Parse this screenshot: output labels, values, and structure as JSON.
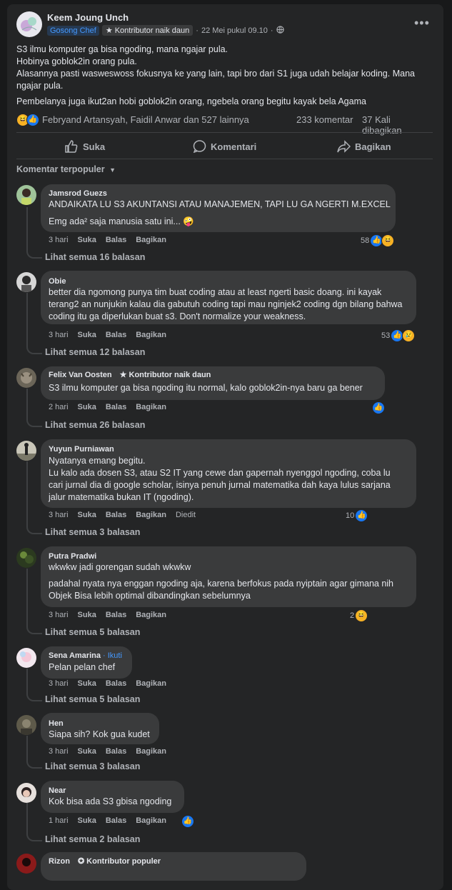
{
  "post": {
    "author": "Keem Joung Unch",
    "badge_group": "Gosong Chef",
    "badge_contrib": "Kontributor naik daun",
    "timestamp": "22 Mei pukul 09.10",
    "privacy_icon": "globe-icon",
    "text": [
      "S3 ilmu komputer ga bisa ngoding, mana ngajar pula.",
      "Hobinya goblok2in orang pula.",
      "Alasannya pasti wasweswoss fokusnya ke yang lain, tapi bro dari S1 juga udah belajar koding. Mana ngajar pula.",
      "Pembelanya juga ikut2an hobi goblok2in orang, ngebela orang begitu kayak bela Agama"
    ],
    "reactors": "Febryand Artansyah, Faidil Anwar dan 527 lainnya",
    "comments_count": "233 komentar",
    "shares_count": "37 Kali dibagikan"
  },
  "actions": {
    "like": "Suka",
    "comment": "Komentari",
    "share": "Bagikan"
  },
  "sort_label": "Komentar terpopuler",
  "labels": {
    "like": "Suka",
    "reply": "Balas",
    "share": "Bagikan",
    "edited": "Diedit"
  },
  "colors": {
    "background": "#18191a",
    "card": "#242526",
    "bubble": "#3a3b3c",
    "accent": "#1877f2",
    "link": "#4599ff"
  },
  "comments": [
    {
      "name": "Jamsrod Guezs",
      "text1": "ANDAIKATA LU S3 AKUNTANSI ATAU MANAJEMEN, TAPI LU GA NGERTI M.EXCEL",
      "text2": "Emg ada² saja manusia satu ini... 🤪",
      "time": "3 hari",
      "react_count": "58",
      "replies": "Lihat semua 16 balasan"
    },
    {
      "name": "Obie",
      "text1": "better dia ngomong punya tim buat coding atau at least ngerti basic doang. ini kayak terang2 an nunjukin kalau dia gabutuh coding tapi mau nginjek2 coding dgn bilang bahwa coding itu ga diperlukan buat s3. Don't normalize your weakness.",
      "time": "3 hari",
      "react_count": "53",
      "replies": "Lihat semua 12 balasan"
    },
    {
      "name": "Felix Van Oosten",
      "badge": "Kontributor naik daun",
      "text1": "S3 ilmu komputer ga bisa ngoding itu normal, kalo goblok2in-nya baru ga bener",
      "time": "2 hari",
      "replies": "Lihat semua 26 balasan"
    },
    {
      "name": "Yuyun Purniawan",
      "text1": "Nyatanya emang begitu.",
      "text2": "Lu kalo ada dosen S3, atau S2 IT yang cewe dan gapernah nyenggol ngoding, coba lu cari jurnal dia di google scholar, isinya penuh jurnal matematika dah kaya lulus sarjana jalur matematika bukan IT (ngoding).",
      "time": "3 hari",
      "react_count": "10",
      "replies": "Lihat semua 3 balasan"
    },
    {
      "name": "Putra Pradwi",
      "text1": "wkwkw jadi gorengan sudah wkwkw",
      "text2": "padahal nyata nya enggan ngoding aja, karena berfokus pada nyiptain agar gimana nih Objek Bisa lebih optimal dibandingkan sebelumnya",
      "time": "3 hari",
      "react_count": "2",
      "replies": "Lihat semua 5 balasan"
    },
    {
      "name": "Sena Amarina",
      "follow": "· Ikuti",
      "text1": "Pelan pelan chef",
      "time": "3 hari",
      "replies": "Lihat semua 5 balasan"
    },
    {
      "name": "Hen",
      "text1": "Siapa sih? Kok gua kudet",
      "time": "3 hari",
      "replies": "Lihat semua 3 balasan"
    },
    {
      "name": "Near",
      "text1": "Kok bisa ada S3 gbisa ngoding",
      "time": "1 hari",
      "replies": "Lihat semua 2 balasan"
    },
    {
      "name": "Rizon",
      "badge": "Kontributor populer"
    }
  ]
}
